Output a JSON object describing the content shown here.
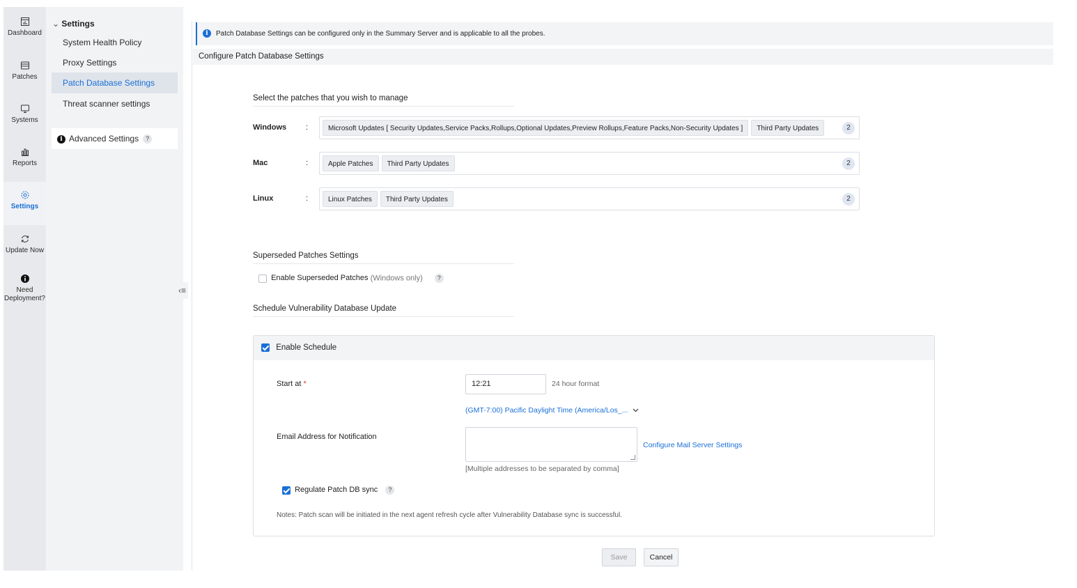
{
  "rail": {
    "items": [
      {
        "label": "Dashboard",
        "icon": "dashboard-icon"
      },
      {
        "label": "Patches",
        "icon": "patches-icon"
      },
      {
        "label": "Systems",
        "icon": "systems-icon"
      },
      {
        "label": "Reports",
        "icon": "reports-icon"
      },
      {
        "label": "Settings",
        "icon": "settings-gear-icon",
        "active": true
      },
      {
        "label": "Update Now",
        "icon": "refresh-icon"
      },
      {
        "label": "Need",
        "label2": "Deployment?",
        "icon": "info-icon"
      }
    ]
  },
  "subnav": {
    "header": "Settings",
    "items": [
      {
        "label": "System Health Policy"
      },
      {
        "label": "Proxy Settings"
      },
      {
        "label": "Patch Database Settings",
        "active": true
      },
      {
        "label": "Threat scanner settings"
      }
    ],
    "advanced": "Advanced Settings",
    "help": "?"
  },
  "banner": {
    "text": "Patch Database Settings can be configured only in the Summary Server and is applicable to all the probes.",
    "icon_glyph": "i"
  },
  "page_title": "Configure Patch Database Settings",
  "patches": {
    "title": "Select the patches that you wish to manage",
    "colon": ":",
    "rows": [
      {
        "os": "Windows",
        "tags": [
          "Microsoft Updates [ Security Updates,Service Packs,Rollups,Optional Updates,Preview Rollups,Feature Packs,Non-Security Updates ]",
          "Third Party Updates"
        ],
        "count": "2"
      },
      {
        "os": "Mac",
        "tags": [
          "Apple Patches",
          "Third Party Updates"
        ],
        "count": "2"
      },
      {
        "os": "Linux",
        "tags": [
          "Linux Patches",
          "Third Party Updates"
        ],
        "count": "2"
      }
    ]
  },
  "superseded": {
    "title": "Superseded Patches Settings",
    "checkbox_label": "Enable Superseded Patches",
    "checkbox_note": "(Windows only)",
    "checked": false,
    "help": "?"
  },
  "schedule": {
    "title": "Schedule Vulnerability Database Update",
    "enable_label": "Enable Schedule",
    "enable_checked": true,
    "start_label": "Start at",
    "required_mark": "*",
    "start_value": "12:21",
    "format_hint": "24 hour format",
    "timezone": "(GMT-7:00) Pacific Daylight Time (America/Los_...",
    "email_label": "Email Address for Notification",
    "email_value": "",
    "mail_link": "Configure Mail Server Settings",
    "email_hint": "[Multiple addresses to be separated by comma]",
    "regulate_label": "Regulate Patch DB sync",
    "regulate_checked": true,
    "help": "?",
    "notes": "Notes: Patch scan will be initiated in the next agent refresh cycle after Vulnerability Database sync is successful."
  },
  "actions": {
    "save": "Save",
    "cancel": "Cancel"
  },
  "colors": {
    "accent": "#1a6fd6",
    "rail_bg": "#e8e9ec",
    "subnav_bg": "#f2f3f5"
  }
}
